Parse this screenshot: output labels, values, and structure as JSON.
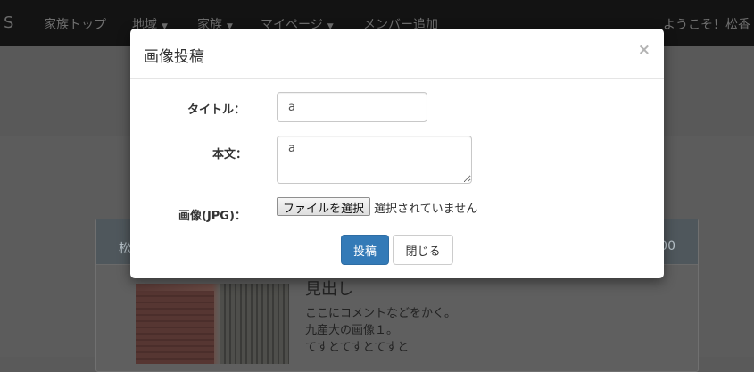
{
  "navbar": {
    "brand": "S",
    "items": [
      {
        "label": "家族トップ",
        "caret": false
      },
      {
        "label": "地域",
        "caret": true
      },
      {
        "label": "家族",
        "caret": true
      },
      {
        "label": "マイページ",
        "caret": true
      },
      {
        "label": "メンバー追加",
        "caret": false
      }
    ],
    "welcome": "ようこそ！松香"
  },
  "panel": {
    "header_left": "松",
    "header_right": "00",
    "post": {
      "title": "見出し",
      "lines": [
        "ここにコメントなどをかく。",
        "九産大の画像１。",
        "てすとてすとてすと"
      ]
    }
  },
  "modal": {
    "title": "画像投稿",
    "close": "×",
    "fields": {
      "title_label": "タイトル：",
      "title_value": "a",
      "body_label": "本文：",
      "body_value": "a",
      "image_label": "画像(JPG)：",
      "file_button": "ファイルを選択",
      "file_status": "選択されていません"
    },
    "buttons": {
      "submit": "投稿",
      "close": "閉じる"
    }
  },
  "colors": {
    "primary": "#337ab7",
    "navbar": "#131313",
    "backdrop": "#5a5a5a"
  }
}
